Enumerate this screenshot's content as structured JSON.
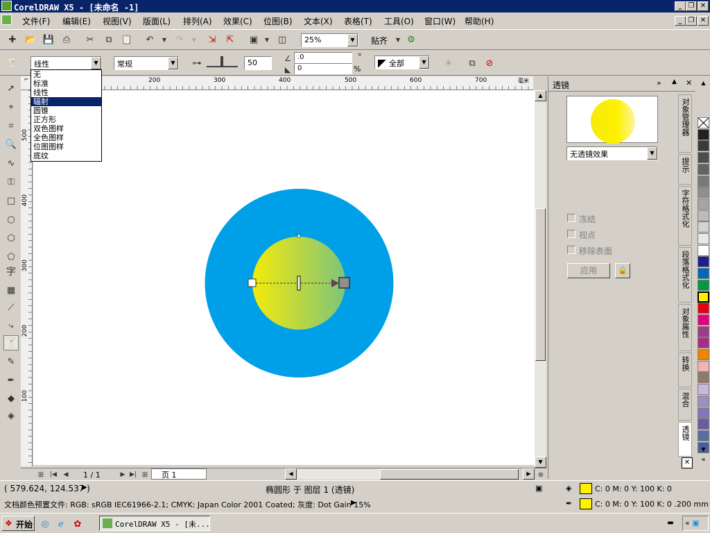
{
  "window": {
    "title": "CorelDRAW X5 - [未命名 -1]",
    "controls": [
      "_",
      "❐",
      "✕"
    ]
  },
  "menu": [
    "文件(F)",
    "编辑(E)",
    "视图(V)",
    "版面(L)",
    "排列(A)",
    "效果(C)",
    "位图(B)",
    "文本(X)",
    "表格(T)",
    "工具(O)",
    "窗口(W)",
    "帮助(H)"
  ],
  "toolbar": {
    "zoom": "25%",
    "snap_label": "贴齐"
  },
  "property_bar": {
    "type_value": "线性",
    "mode_value": "常规",
    "midpoint_value": "50",
    "angle_value": ".0",
    "edge_value": "0",
    "angle_unit": "°",
    "edge_unit": "%",
    "apply_to": "全部"
  },
  "transparency_types": [
    "无",
    "标准",
    "线性",
    "辐射",
    "圆锥",
    "正方形",
    "双色图样",
    "全色图样",
    "位图图样",
    "底纹"
  ],
  "transparency_selected_index": 3,
  "ruler_h_ticks": [
    "200",
    "300",
    "400",
    "500",
    "600",
    "700"
  ],
  "ruler_h_unit": "毫米",
  "ruler_v_ticks": [
    "500",
    "400",
    "300",
    "200",
    "100"
  ],
  "page_nav": {
    "count": "1 / 1",
    "tab": "页 1"
  },
  "docker": {
    "title": "透镜",
    "lens_effect": "无透镜效果",
    "freeze": "冻结",
    "viewpoint": "视点",
    "remove_face": "移除表面",
    "apply": "应用"
  },
  "vertical_tabs": [
    "对象管理器",
    "提示",
    "字符格式化",
    "段落格式化",
    "对象属性",
    "转换",
    "混合",
    "透镜"
  ],
  "palette_colors": [
    "#ffffff",
    "#231f20",
    "#3a3a3a",
    "#4d4d4d",
    "#636363",
    "#797979",
    "#8f8f8f",
    "#a5a5a5",
    "#bcbcbc",
    "#d2d2d2",
    "#e8e8e8",
    "#ffffff",
    "#1d2088",
    "#0068b7",
    "#009944",
    "#fff100",
    "#e60012",
    "#e4007f",
    "#9c3b8b",
    "#a62f81",
    "#f08300",
    "#f5b2b2",
    "#8f7a6b",
    "#c9b8d8",
    "#9e8fc3",
    "#8476b5",
    "#6a5ba2",
    "#5c6ea0",
    "#47609c"
  ],
  "status": {
    "coords": "( 579.624, 124.537 )",
    "object_info": "椭圆形 于 图层 1 (透镜)",
    "doc_profile": "文档颜色预置文件: RGB: sRGB IEC61966-2.1; CMYK: Japan Color 2001 Coated; 灰度: Dot Gain 15%",
    "fill_info": "C: 0 M: 0 Y: 100 K: 0",
    "outline_info": "C: 0 M: 0 Y: 100 K: 0  .200 mm"
  },
  "colors": {
    "outer_circle": "#00a0e9",
    "gradient_start": "#f4ea0b",
    "gradient_end": "#7fc47a",
    "yellow": "#fff100"
  },
  "taskbar": {
    "start": "开始",
    "app": "CorelDRAW X5 - [未..."
  }
}
